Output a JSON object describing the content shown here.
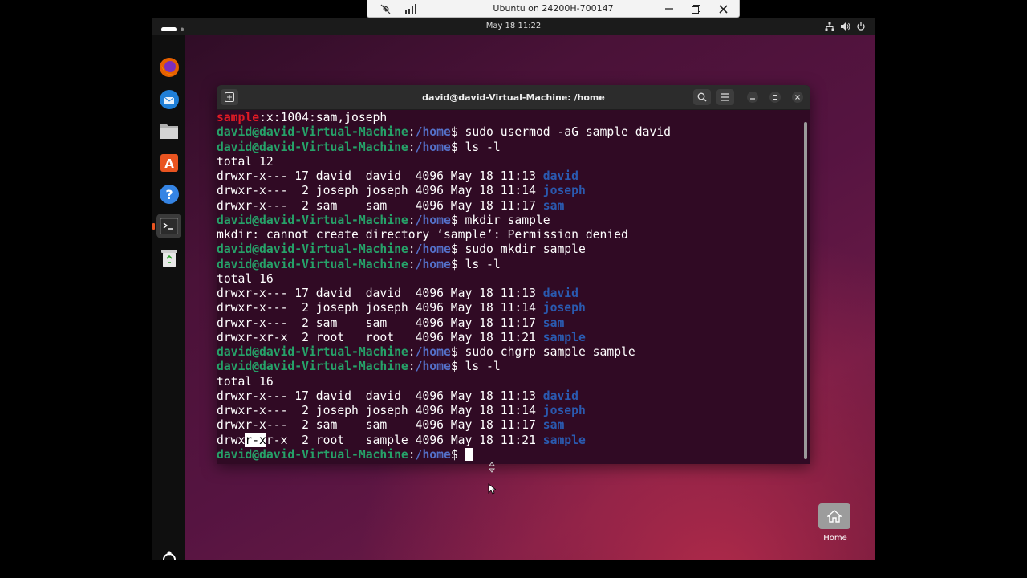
{
  "rdp": {
    "title": "Ubuntu on 24200H-700147"
  },
  "topbar": {
    "datetime": "May 18  11:22"
  },
  "terminal": {
    "title": "david@david-Virtual-Machine: /home",
    "prompt_user": "david@david-Virtual-Machine",
    "prompt_sep": ":",
    "prompt_path": "/home",
    "prompt_dollar": "$ ",
    "lines": [
      {
        "type": "group",
        "name": "sample",
        "rest": ":x:1004:sam,joseph"
      },
      {
        "type": "prompt",
        "cmd": "sudo usermod -aG sample david"
      },
      {
        "type": "prompt",
        "cmd": "ls -l"
      },
      {
        "type": "text",
        "text": "total 12"
      },
      {
        "type": "ls",
        "text": "drwxr-x--- 17 david  david  4096 May 18 11:13 ",
        "name": "david"
      },
      {
        "type": "ls",
        "text": "drwxr-x---  2 joseph joseph 4096 May 18 11:14 ",
        "name": "joseph"
      },
      {
        "type": "ls",
        "text": "drwxr-x---  2 sam    sam    4096 May 18 11:17 ",
        "name": "sam"
      },
      {
        "type": "prompt",
        "cmd": "mkdir sample"
      },
      {
        "type": "text",
        "text": "mkdir: cannot create directory ‘sample’: Permission denied"
      },
      {
        "type": "prompt",
        "cmd": "sudo mkdir sample"
      },
      {
        "type": "prompt",
        "cmd": "ls -l"
      },
      {
        "type": "text",
        "text": "total 16"
      },
      {
        "type": "ls",
        "text": "drwxr-x--- 17 david  david  4096 May 18 11:13 ",
        "name": "david"
      },
      {
        "type": "ls",
        "text": "drwxr-x---  2 joseph joseph 4096 May 18 11:14 ",
        "name": "joseph"
      },
      {
        "type": "ls",
        "text": "drwxr-x---  2 sam    sam    4096 May 18 11:17 ",
        "name": "sam"
      },
      {
        "type": "ls",
        "text": "drwxr-xr-x  2 root   root   4096 May 18 11:21 ",
        "name": "sample"
      },
      {
        "type": "prompt",
        "cmd": "sudo chgrp sample sample"
      },
      {
        "type": "prompt",
        "cmd": "ls -l"
      },
      {
        "type": "text",
        "text": "total 16"
      },
      {
        "type": "ls",
        "text": "drwxr-x--- 17 david  david  4096 May 18 11:13 ",
        "name": "david"
      },
      {
        "type": "ls",
        "text": "drwxr-x---  2 joseph joseph 4096 May 18 11:14 ",
        "name": "joseph"
      },
      {
        "type": "ls",
        "text": "drwxr-x---  2 sam    sam    4096 May 18 11:17 ",
        "name": "sam"
      },
      {
        "type": "lssel",
        "pre": "drwx",
        "sel": "r-x",
        "post": "r-x  2 root   sample 4096 May 18 11:21 ",
        "name": "sample"
      },
      {
        "type": "prompt",
        "cmd": "",
        "cursor": true
      }
    ]
  },
  "desktop": {
    "home_label": "Home"
  },
  "dock": [
    "firefox-icon",
    "thunderbird-icon",
    "files-icon",
    "app-center-icon",
    "help-icon",
    "terminal-icon",
    "trash-icon"
  ],
  "colors": {
    "terminal_bg": "#300a24",
    "prompt_user": "#26a269",
    "prompt_path": "#5470c8",
    "dir": "#2a5ab0",
    "group": "#e01b24"
  }
}
